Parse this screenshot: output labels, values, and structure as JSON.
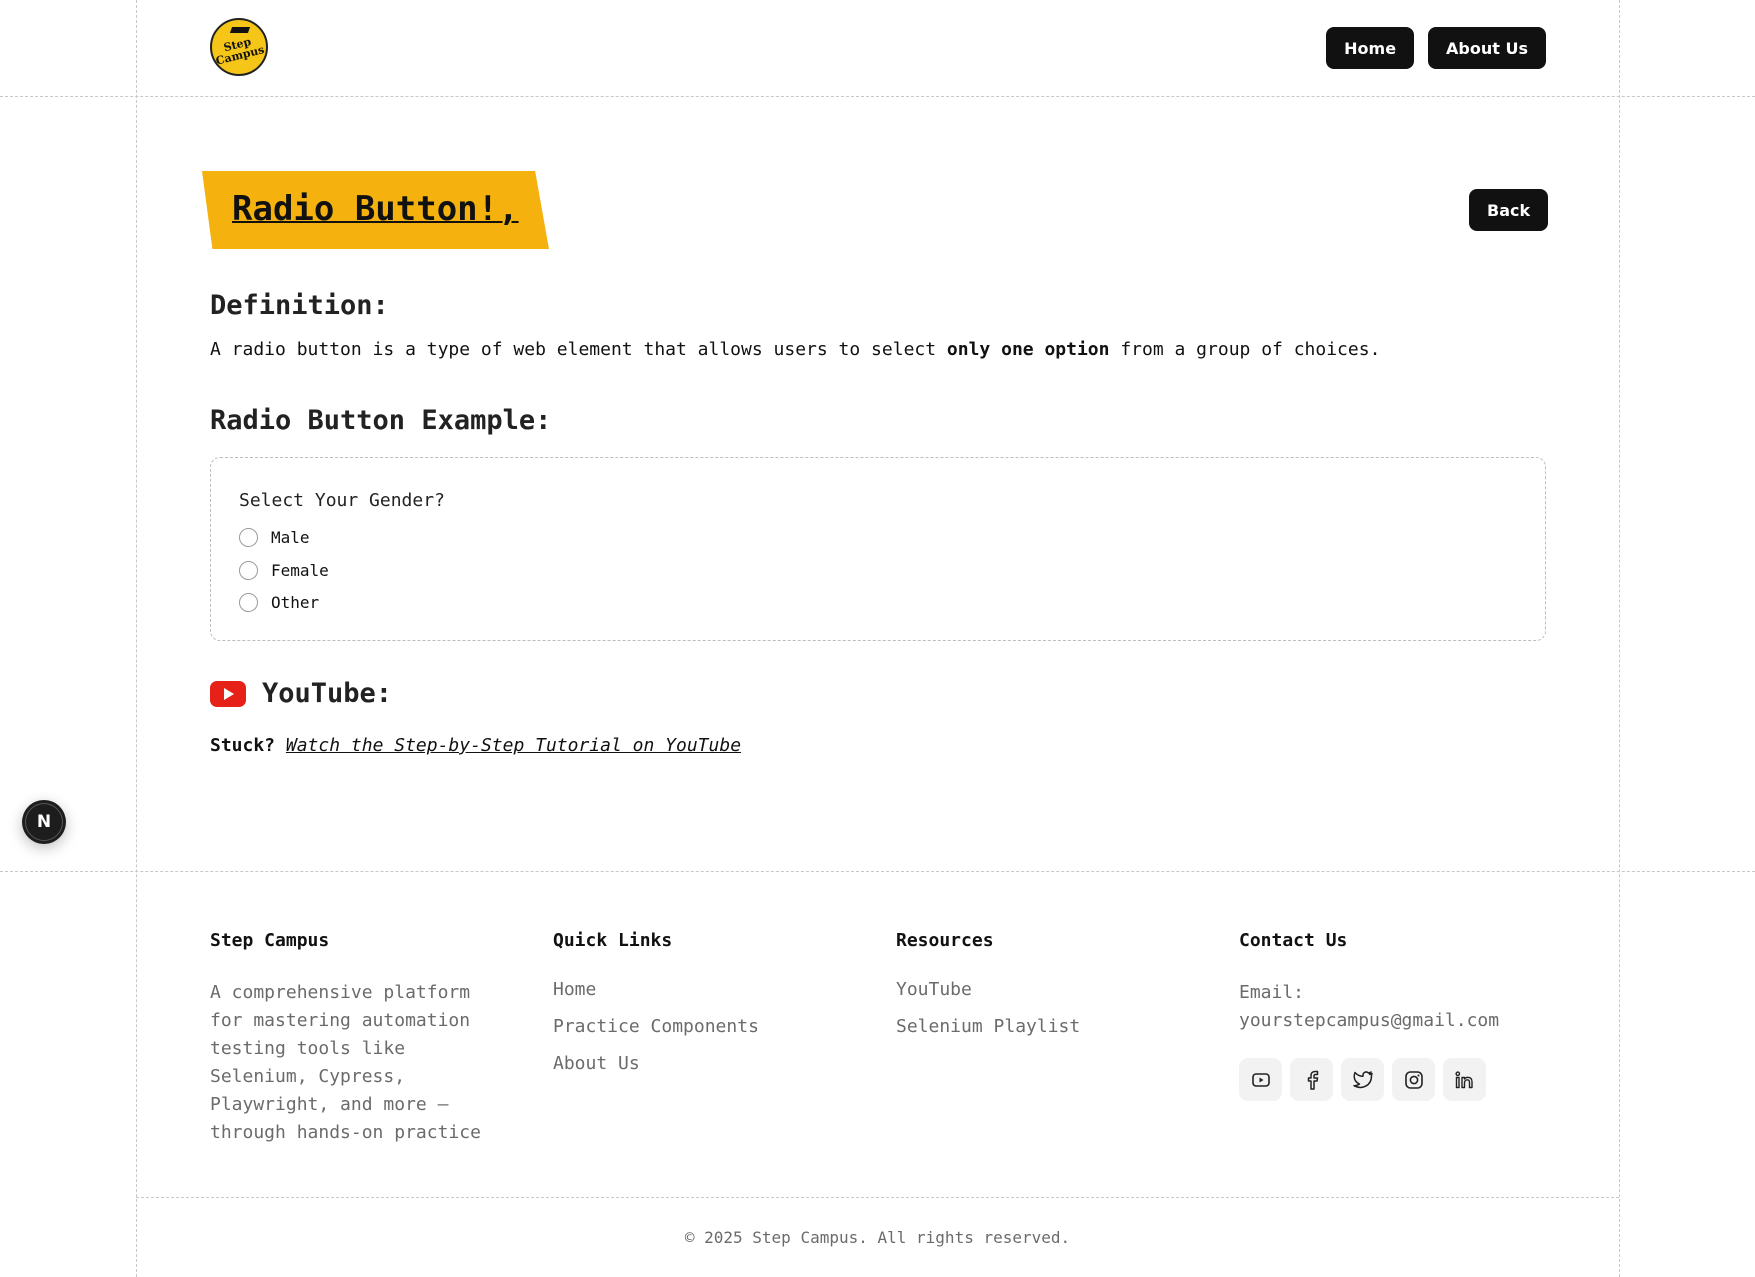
{
  "header": {
    "logo_text_1": "Step",
    "logo_text_2": "Campus",
    "nav": {
      "home": "Home",
      "about": "About Us"
    }
  },
  "main": {
    "title": "Radio Button!,",
    "back_label": "Back",
    "definition_heading": "Definition:",
    "definition_before": "A radio button is a type of web element that allows users to select ",
    "definition_bold": "only one option",
    "definition_after": " from a group of choices.",
    "example_heading": "Radio Button Example:",
    "question": "Select Your Gender?",
    "options": [
      {
        "label": "Male",
        "checked": false
      },
      {
        "label": "Female",
        "checked": false
      },
      {
        "label": "Other",
        "checked": false
      }
    ],
    "youtube_heading": "YouTube:",
    "stuck_label": "Stuck?",
    "tutorial_link": "Watch the Step-by-Step Tutorial on YouTube"
  },
  "dev_badge": "N",
  "footer": {
    "brand": {
      "heading": "Step Campus",
      "description_lines": [
        "A comprehensive platform",
        "for mastering automation",
        "testing tools like",
        "Selenium, Cypress,",
        "Playwright, and more —",
        "through hands-on practice"
      ]
    },
    "quick_links": {
      "heading": "Quick Links",
      "items": [
        "Home",
        "Practice Components",
        "About Us"
      ]
    },
    "resources": {
      "heading": "Resources",
      "items": [
        "YouTube",
        "Selenium Playlist"
      ]
    },
    "contact": {
      "heading": "Contact Us",
      "email_label": "Email:",
      "email": "yourstepcampus@gmail.com",
      "social_icons": [
        "youtube-icon",
        "facebook-icon",
        "twitter-icon",
        "instagram-icon",
        "linkedin-icon"
      ]
    },
    "copyright": "© 2025 Step Campus. All rights reserved."
  },
  "colors": {
    "accent": "#f5b20f",
    "button_dark": "#111111",
    "youtube_red": "#e62117",
    "muted_text": "#6b6b6b"
  }
}
